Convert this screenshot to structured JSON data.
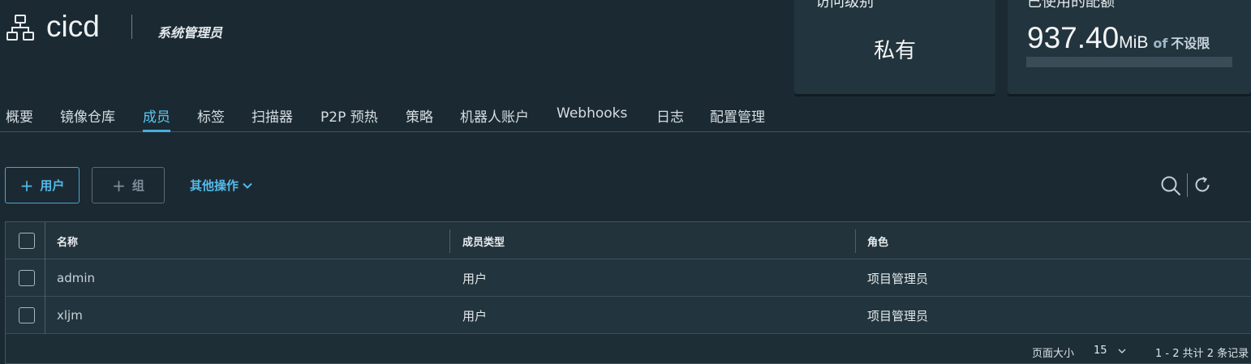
{
  "project": {
    "name": "cicd",
    "role": "系统管理员",
    "icon": "project-hierarchy-icon"
  },
  "cards": {
    "access": {
      "title": "访问级别",
      "value": "私有"
    },
    "quota": {
      "title": "已使用的配额",
      "used_number": "937.40",
      "used_unit": "MiB",
      "of": "of",
      "limit": "不设限",
      "usage_fraction": 0.0
    }
  },
  "tabs": [
    {
      "label": "概要",
      "active": false
    },
    {
      "label": "镜像仓库",
      "active": false
    },
    {
      "label": "成员",
      "active": true
    },
    {
      "label": "标签",
      "active": false
    },
    {
      "label": "扫描器",
      "active": false
    },
    {
      "label": "P2P 预热",
      "active": false
    },
    {
      "label": "策略",
      "active": false
    },
    {
      "label": "机器人账户",
      "active": false
    },
    {
      "label": "Webhooks",
      "active": false
    },
    {
      "label": "日志",
      "active": false
    },
    {
      "label": "配置管理",
      "active": false
    }
  ],
  "toolbar": {
    "add_user_label": "用户",
    "add_group_label": "组",
    "more_actions_label": "其他操作",
    "icons": [
      "plus-icon",
      "chevron-down-icon",
      "search-icon",
      "refresh-icon"
    ]
  },
  "table": {
    "columns": [
      "名称",
      "成员类型",
      "角色"
    ],
    "rows": [
      {
        "name": "admin",
        "type": "用户",
        "role": "项目管理员"
      },
      {
        "name": "xljm",
        "type": "用户",
        "role": "项目管理员"
      }
    ]
  },
  "pagination": {
    "page_size_label": "页面大小",
    "page_size": "15",
    "record_info": "1 - 2 共计 2 条记录"
  },
  "colors": {
    "background": "#1b2a32",
    "accent": "#49aedf",
    "card": "#22343d"
  }
}
